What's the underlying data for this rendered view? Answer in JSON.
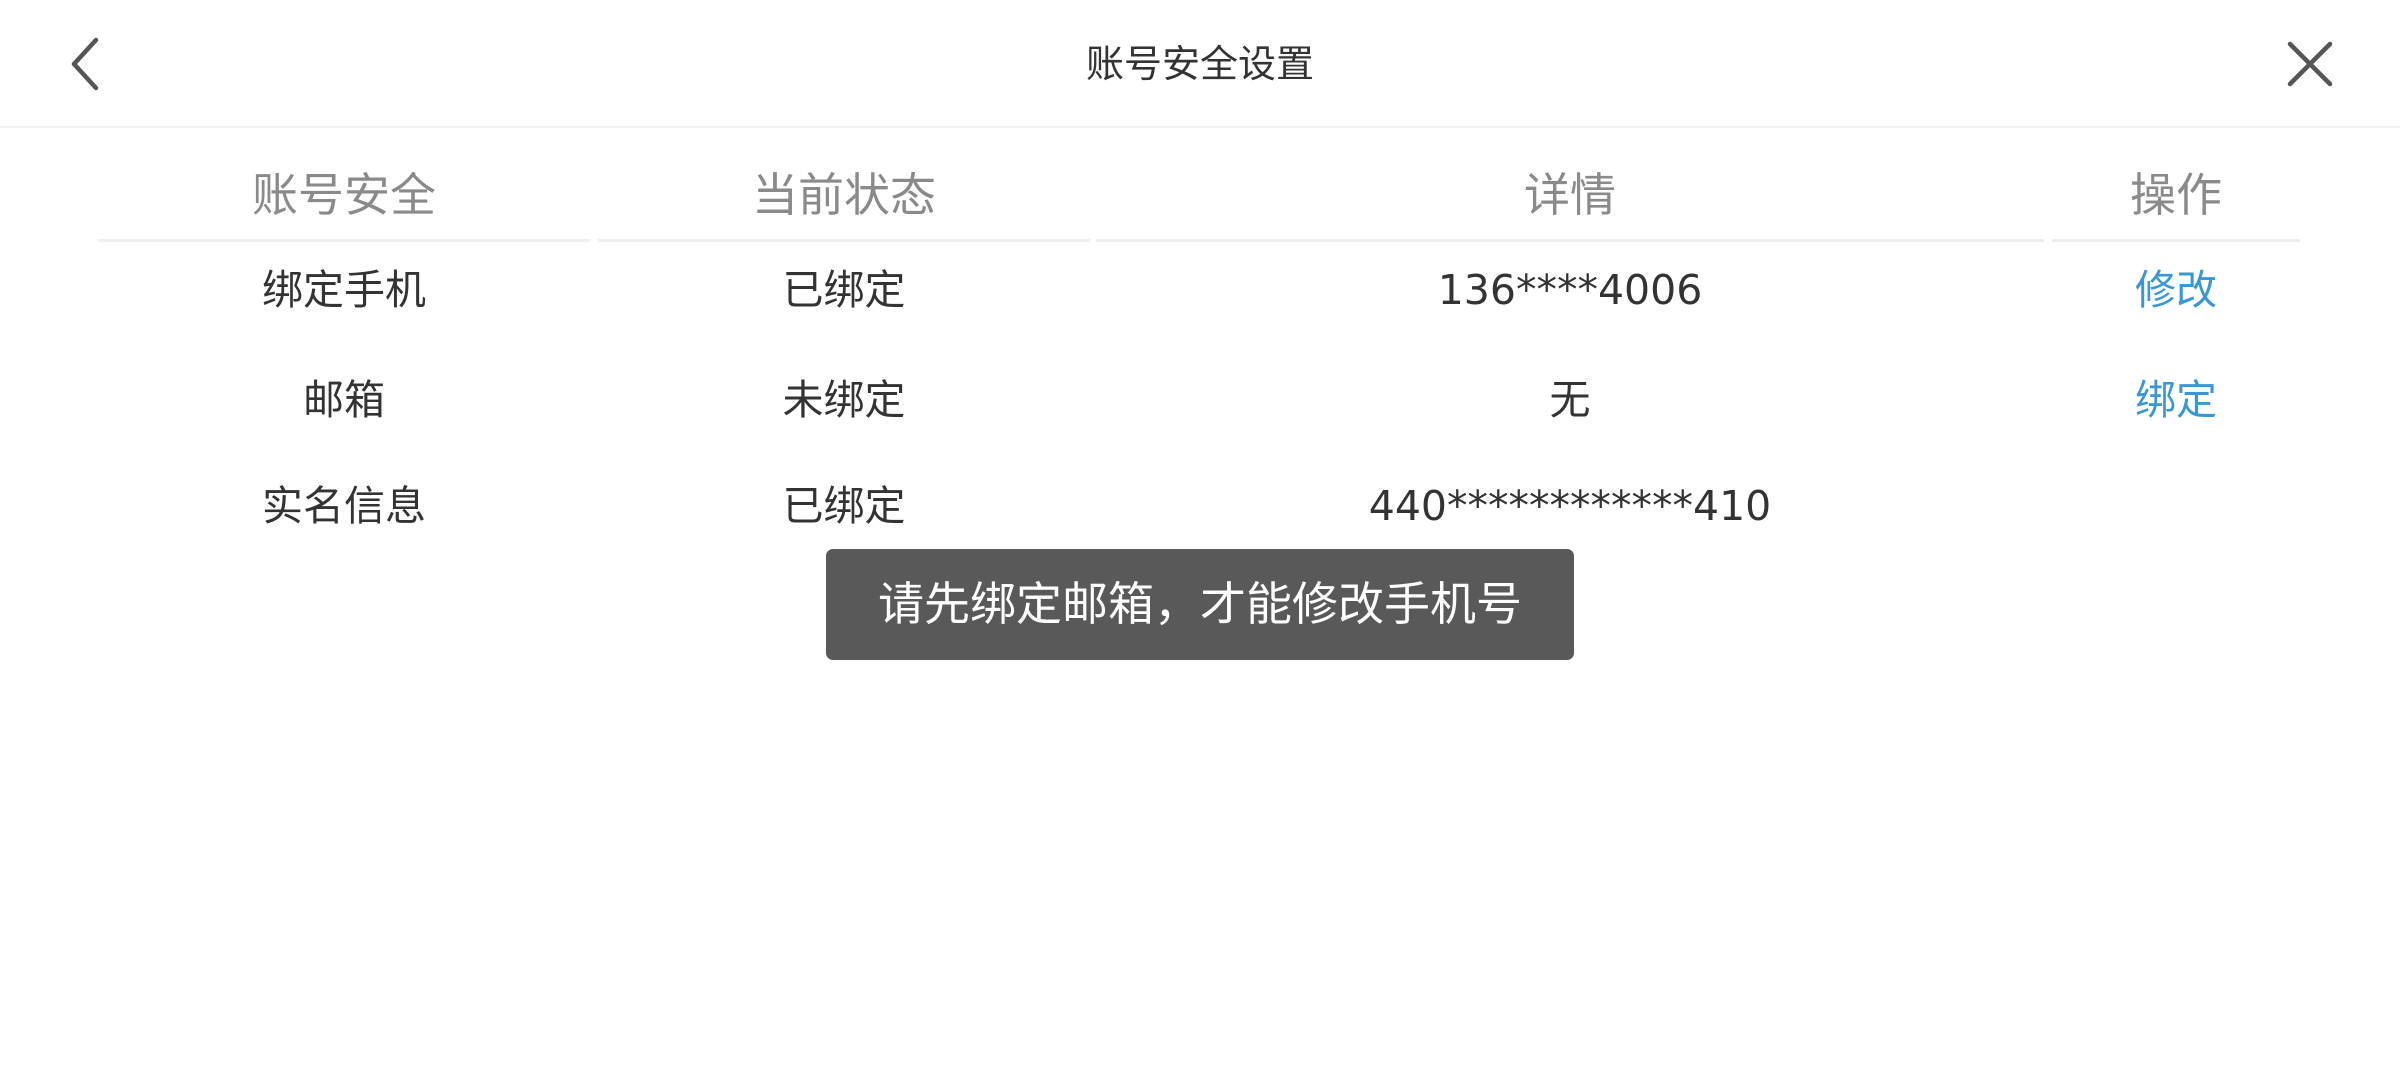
{
  "header": {
    "title": "账号安全设置",
    "back_icon": "chevron-left-icon",
    "close_icon": "close-icon"
  },
  "table": {
    "columns": [
      "账号安全",
      "当前状态",
      "详情",
      "操作"
    ],
    "rows": [
      {
        "item": "绑定手机",
        "status": "已绑定",
        "detail": "136****4006",
        "action": "修改"
      },
      {
        "item": "邮箱",
        "status": "未绑定",
        "detail": "无",
        "action": "绑定"
      },
      {
        "item": "实名信息",
        "status": "已绑定",
        "detail": "440************410",
        "action": ""
      }
    ]
  },
  "toast": {
    "message": "请先绑定邮箱，才能修改手机号"
  },
  "colors": {
    "action_link": "#3a97d6",
    "toast_background": "#595959",
    "header_text": "#333333",
    "column_header_text": "#8a8a8a"
  }
}
